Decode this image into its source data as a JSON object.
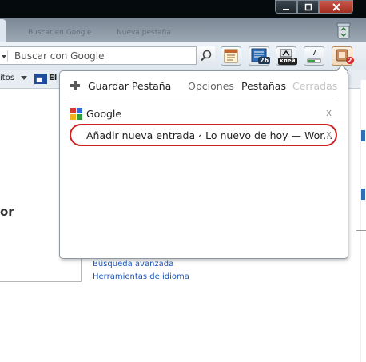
{
  "browser": {
    "search": {
      "placeholder": "Buscar con Google"
    },
    "toolbar": {
      "badge_26": "26",
      "badge_klei": "клей",
      "badge_7": "7",
      "badge_2": "2"
    },
    "bookmarks": [
      {
        "label": "itos"
      },
      {
        "label": "El"
      }
    ],
    "ghost_tabs": [
      "Buscar en Google",
      "Nueva pestaña"
    ]
  },
  "popup": {
    "save_label": "Guardar Pestaña",
    "nav": [
      {
        "label": "Opciones",
        "state": "normal"
      },
      {
        "label": "Pestañas",
        "state": "active"
      },
      {
        "label": "Cerradas",
        "state": "disabled"
      }
    ],
    "tabs": [
      {
        "title": "Google",
        "icon": "google-icon",
        "highlighted": false
      },
      {
        "title": "Añadir nueva entrada ‹ Lo nuevo de hoy — Wor...",
        "icon": "none",
        "highlighted": true
      }
    ],
    "close_glyph": "x"
  },
  "page": {
    "big_text": "or",
    "links": [
      "Búsqueda avanzada",
      "Herramientas de idioma"
    ]
  },
  "colors": {
    "highlight_oval": "#cc2222",
    "link": "#1a55b6",
    "disabled": "#c4c4c4"
  }
}
